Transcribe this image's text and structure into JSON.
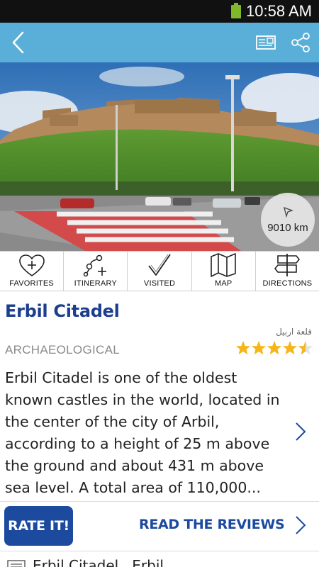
{
  "status_bar": {
    "time": "10:58 AM"
  },
  "app_bar": {
    "back_icon": "chevron-left-icon",
    "postcard_icon": "postcard-icon",
    "share_icon": "share-icon"
  },
  "hero": {
    "distance": "9010 km"
  },
  "actions": [
    {
      "label": "FAVORITES",
      "icon": "heart-plus-icon"
    },
    {
      "label": "ITINERARY",
      "icon": "itinerary-icon"
    },
    {
      "label": "VISITED",
      "icon": "checkmark-icon"
    },
    {
      "label": "MAP",
      "icon": "map-icon"
    },
    {
      "label": "DIRECTIONS",
      "icon": "signpost-icon"
    }
  ],
  "place": {
    "title": "Erbil Citadel",
    "native_name": "قلعة اربيل",
    "category": "ARCHAEOLOGICAL",
    "rating": 4.5,
    "description": "Erbil Citadel is one of the oldest known castles in the world, located in the center of the city of Arbil, according to a height of 25 m above the ground and about 431 m above sea level. A total area of 110,000...",
    "address": "Erbil Citadel , Erbil"
  },
  "buttons": {
    "rate_label": "RATE IT!",
    "reviews_label": "READ THE REVIEWS"
  },
  "colors": {
    "app_bar": "#5aafd9",
    "title": "#1b3e8f",
    "button": "#1b4a9e",
    "star": "#f5b619"
  }
}
